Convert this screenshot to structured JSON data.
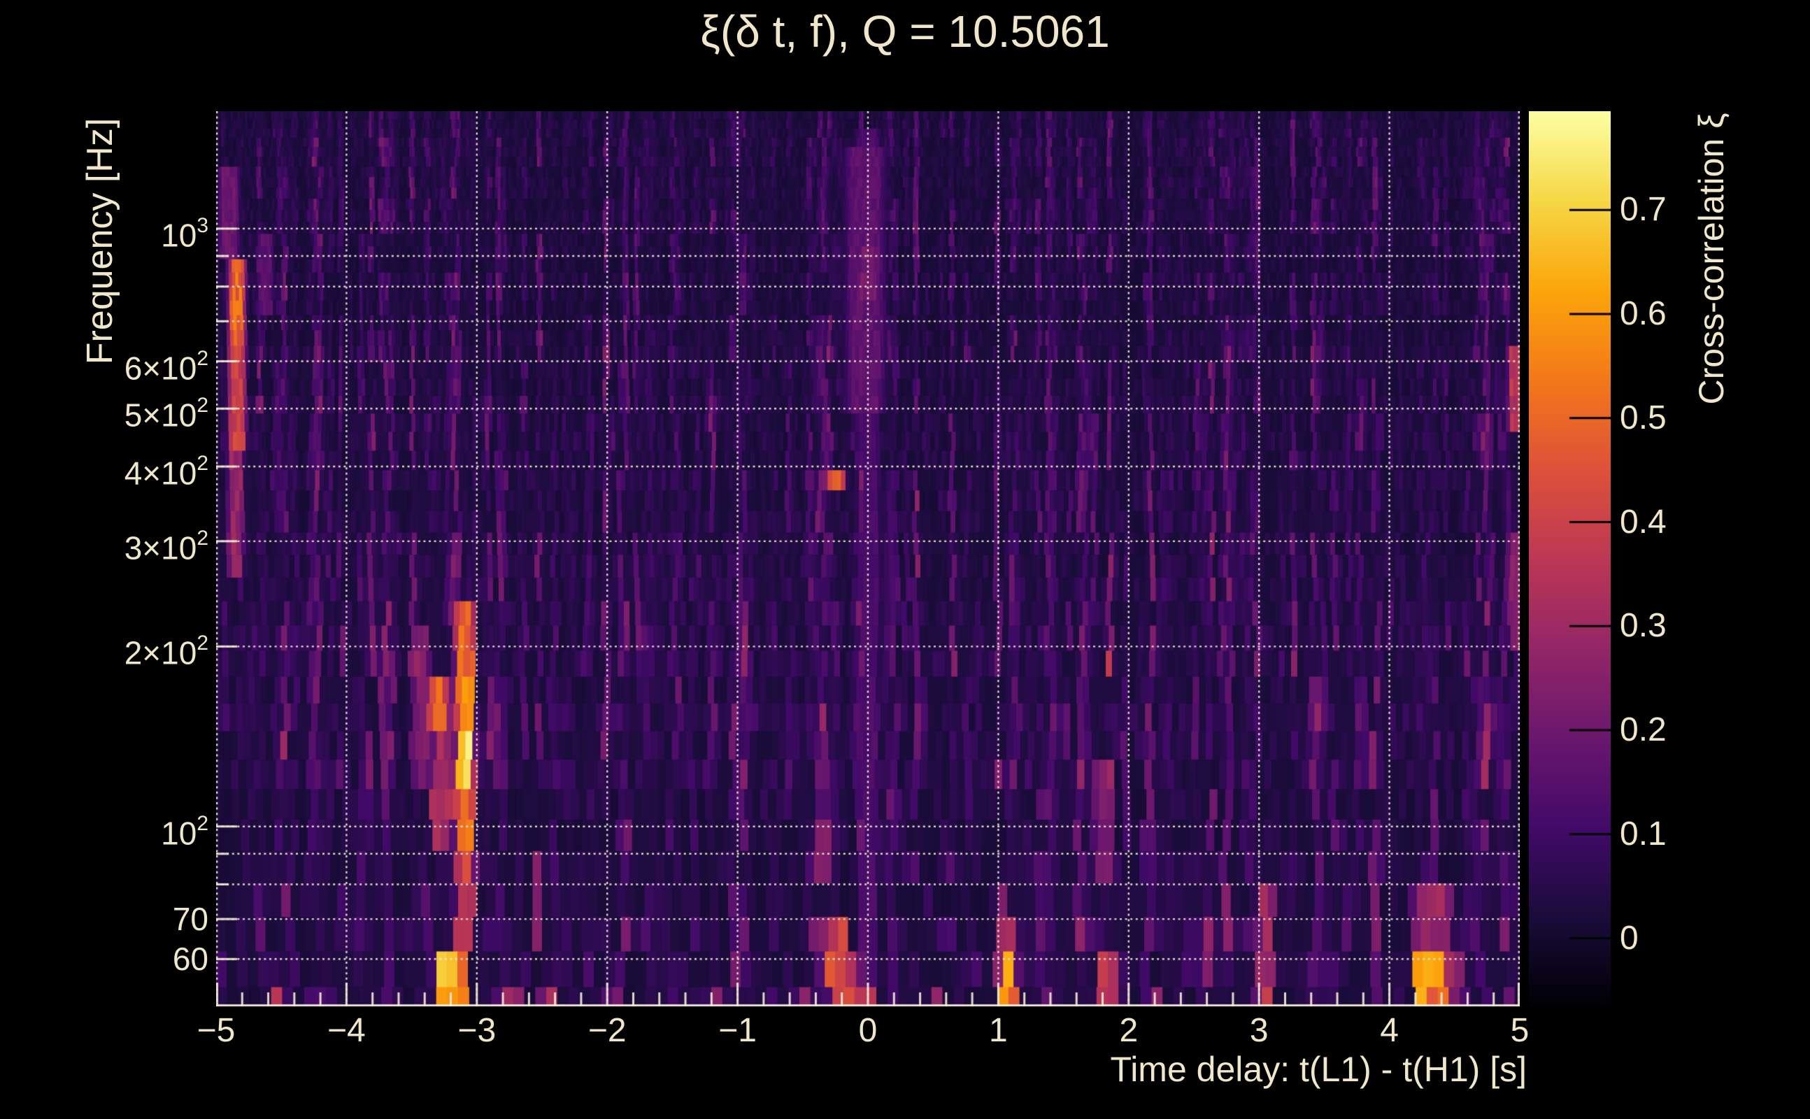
{
  "title": "ξ(δ t, f), Q = 10.5061",
  "x_axis": {
    "title": "Time delay: t(L1) - t(H1) [s]",
    "min": -5,
    "max": 5,
    "major_tick_values": [
      -5,
      -4,
      -3,
      -2,
      -1,
      0,
      1,
      2,
      3,
      4,
      5
    ],
    "major_tick_labels": [
      "−5",
      "−4",
      "−3",
      "−2",
      "−1",
      "0",
      "1",
      "2",
      "3",
      "4",
      "5"
    ],
    "minor_tick_step": 0.2
  },
  "y_axis": {
    "title": "Frequency [Hz]",
    "scale": "log",
    "min_hz": 50,
    "max_hz": 1572,
    "tick_labels": [
      {
        "base": "10",
        "exp": "3",
        "hz": 1000
      },
      {
        "base": "6×10",
        "exp": "2",
        "hz": 600
      },
      {
        "base": "5×10",
        "exp": "2",
        "hz": 500
      },
      {
        "base": "4×10",
        "exp": "2",
        "hz": 400
      },
      {
        "base": "3×10",
        "exp": "2",
        "hz": 300
      },
      {
        "base": "2×10",
        "exp": "2",
        "hz": 200
      },
      {
        "base": "10",
        "exp": "2",
        "hz": 100
      },
      {
        "base": "70",
        "exp": "",
        "hz": 70
      },
      {
        "base": "60",
        "exp": "",
        "hz": 60
      }
    ],
    "gridline_hz": [
      60,
      70,
      80,
      90,
      100,
      200,
      300,
      400,
      500,
      600,
      700,
      800,
      900,
      1000
    ]
  },
  "colorbar": {
    "title": "Cross-correlation ξ",
    "vmin": -0.0655,
    "vmax": 0.795,
    "tick_values": [
      0.7,
      0.6,
      0.5,
      0.4,
      0.3,
      0.2,
      0.1,
      0
    ],
    "tick_labels": [
      "0.7",
      "0.6",
      "0.5",
      "0.4",
      "0.3",
      "0.2",
      "0.1",
      "0"
    ],
    "colormap": "inferno"
  },
  "style": {
    "background": "#000000",
    "text_color": "#f0e7ca",
    "grid_color": "rgba(244,236,214,0.92)"
  },
  "chart_data": {
    "type": "heatmap",
    "title": "ξ(δ t, f), Q = 10.5061",
    "xlabel": "Time delay: t(L1) - t(H1) [s]",
    "ylabel": "Frequency [Hz]",
    "zlabel": "Cross-correlation ξ",
    "x_range": [
      -5,
      5
    ],
    "x_major_ticks": [
      -5,
      -4,
      -3,
      -2,
      -1,
      0,
      1,
      2,
      3,
      4,
      5
    ],
    "x_minor_step": 0.2,
    "y_scale": "log",
    "y_range_hz": [
      50,
      1572
    ],
    "y_labeled_ticks_hz": [
      60,
      70,
      100,
      200,
      300,
      400,
      500,
      600,
      1000
    ],
    "y_grid_hz": [
      60,
      70,
      80,
      90,
      100,
      200,
      300,
      400,
      500,
      600,
      700,
      800,
      900,
      1000
    ],
    "z_range": [
      -0.0655,
      0.795
    ],
    "z_ticks": [
      0,
      0.1,
      0.2,
      0.3,
      0.4,
      0.5,
      0.6,
      0.7
    ],
    "colormap": "inferno",
    "background_xi": 0.02,
    "noise": {
      "column_slots": 256,
      "streak_max_xi": 0.18,
      "cell_noise_xi": 0.05
    },
    "features": [
      {
        "t": -4.84,
        "dt": 0.045,
        "f_lo": 430,
        "f_hi": 900,
        "xi": 0.42
      },
      {
        "t": -4.84,
        "dt": 0.04,
        "f_lo": 640,
        "f_hi": 890,
        "xi": 0.5
      },
      {
        "t": -4.85,
        "dt": 0.04,
        "f_lo": 260,
        "f_hi": 430,
        "xi": 0.28
      },
      {
        "t": -4.9,
        "dt": 0.05,
        "f_lo": 900,
        "f_hi": 1250,
        "xi": 0.2
      },
      {
        "t": -4.62,
        "dt": 0.04,
        "f_lo": 700,
        "f_hi": 1000,
        "xi": 0.16
      },
      {
        "t": -4.52,
        "dt": 0.04,
        "f_lo": 50,
        "f_hi": 57,
        "xi": 0.34
      },
      {
        "t": -3.09,
        "dt": 0.05,
        "f_lo": 96,
        "f_hi": 230,
        "xi": 0.55
      },
      {
        "t": -3.09,
        "dt": 0.04,
        "f_lo": 112,
        "f_hi": 152,
        "xi": 0.78
      },
      {
        "t": -3.09,
        "dt": 0.05,
        "f_lo": 62,
        "f_hi": 96,
        "xi": 0.4
      },
      {
        "t": -3.14,
        "dt": 0.05,
        "f_lo": 50,
        "f_hi": 60,
        "xi": 0.5
      },
      {
        "t": -3.22,
        "dt": 0.07,
        "f_lo": 50,
        "f_hi": 58,
        "xi": 0.62
      },
      {
        "t": -3.26,
        "dt": 0.05,
        "f_lo": 95,
        "f_hi": 170,
        "xi": 0.32
      },
      {
        "t": -3.3,
        "dt": 0.05,
        "f_lo": 148,
        "f_hi": 175,
        "xi": 0.48
      },
      {
        "t": -3.33,
        "dt": 0.03,
        "f_lo": 100,
        "f_hi": 122,
        "xi": 0.3
      },
      {
        "t": -3.42,
        "dt": 0.04,
        "f_lo": 120,
        "f_hi": 210,
        "xi": 0.26
      },
      {
        "t": -2.72,
        "dt": 0.04,
        "f_lo": 50,
        "f_hi": 57,
        "xi": 0.3
      },
      {
        "t": -2.45,
        "dt": 0.04,
        "f_lo": 50,
        "f_hi": 57,
        "xi": 0.34
      },
      {
        "t": -1.95,
        "dt": 0.03,
        "f_lo": 50,
        "f_hi": 56,
        "xi": 0.22
      },
      {
        "t": -1.15,
        "dt": 0.03,
        "f_lo": 50,
        "f_hi": 56,
        "xi": 0.25
      },
      {
        "t": -0.5,
        "dt": 0.04,
        "f_lo": 50,
        "f_hi": 57,
        "xi": 0.3
      },
      {
        "t": -0.37,
        "dt": 0.04,
        "f_lo": 60,
        "f_hi": 72,
        "xi": 0.28
      },
      {
        "t": -0.34,
        "dt": 0.04,
        "f_lo": 80,
        "f_hi": 100,
        "xi": 0.25
      },
      {
        "t": -0.25,
        "dt": 0.05,
        "f_lo": 352,
        "f_hi": 380,
        "xi": 0.5
      },
      {
        "t": -0.25,
        "dt": 0.06,
        "f_lo": 57,
        "f_hi": 72,
        "xi": 0.42
      },
      {
        "t": -0.19,
        "dt": 0.05,
        "f_lo": 50,
        "f_hi": 58,
        "xi": 0.4
      },
      {
        "t": 0.0,
        "dt": 0.06,
        "f_lo": 55,
        "f_hi": 1450,
        "xi": 0.13
      },
      {
        "t": -0.02,
        "dt": 0.1,
        "f_lo": 500,
        "f_hi": 1350,
        "xi": 0.17
      },
      {
        "t": 0.0,
        "dt": 0.05,
        "f_lo": 750,
        "f_hi": 950,
        "xi": 0.22
      },
      {
        "t": -0.02,
        "dt": 0.04,
        "f_lo": 50,
        "f_hi": 57,
        "xi": 0.42
      },
      {
        "t": 0.5,
        "dt": 0.03,
        "f_lo": 50,
        "f_hi": 56,
        "xi": 0.25
      },
      {
        "t": 1.02,
        "dt": 0.03,
        "f_lo": 62,
        "f_hi": 85,
        "xi": 0.22
      },
      {
        "t": 1.07,
        "dt": 0.05,
        "f_lo": 50,
        "f_hi": 62,
        "xi": 0.58
      },
      {
        "t": 1.07,
        "dt": 0.04,
        "f_lo": 62,
        "f_hi": 72,
        "xi": 0.35
      },
      {
        "t": 1.35,
        "dt": 0.03,
        "f_lo": 50,
        "f_hi": 56,
        "xi": 0.2
      },
      {
        "t": 1.8,
        "dt": 0.05,
        "f_lo": 85,
        "f_hi": 130,
        "xi": 0.22
      },
      {
        "t": 1.83,
        "dt": 0.04,
        "f_lo": 50,
        "f_hi": 58,
        "xi": 0.42
      },
      {
        "t": 2.2,
        "dt": 0.04,
        "f_lo": 50,
        "f_hi": 57,
        "xi": 0.3
      },
      {
        "t": 2.6,
        "dt": 0.04,
        "f_lo": 55,
        "f_hi": 70,
        "xi": 0.26
      },
      {
        "t": 3.05,
        "dt": 0.04,
        "f_lo": 57,
        "f_hi": 85,
        "xi": 0.32
      },
      {
        "t": 3.05,
        "dt": 0.04,
        "f_lo": 50,
        "f_hi": 57,
        "xi": 0.35
      },
      {
        "t": 4.26,
        "dt": 0.05,
        "f_lo": 50,
        "f_hi": 64,
        "xi": 0.62
      },
      {
        "t": 4.39,
        "dt": 0.05,
        "f_lo": 50,
        "f_hi": 66,
        "xi": 0.58
      },
      {
        "t": 4.33,
        "dt": 0.1,
        "f_lo": 64,
        "f_hi": 80,
        "xi": 0.3
      },
      {
        "t": 4.52,
        "dt": 0.04,
        "f_lo": 50,
        "f_hi": 60,
        "xi": 0.25
      },
      {
        "t": 4.97,
        "dt": 0.04,
        "f_lo": 470,
        "f_hi": 630,
        "xi": 0.36
      },
      {
        "t": 4.97,
        "dt": 0.04,
        "f_lo": 200,
        "f_hi": 300,
        "xi": 0.25
      }
    ]
  }
}
